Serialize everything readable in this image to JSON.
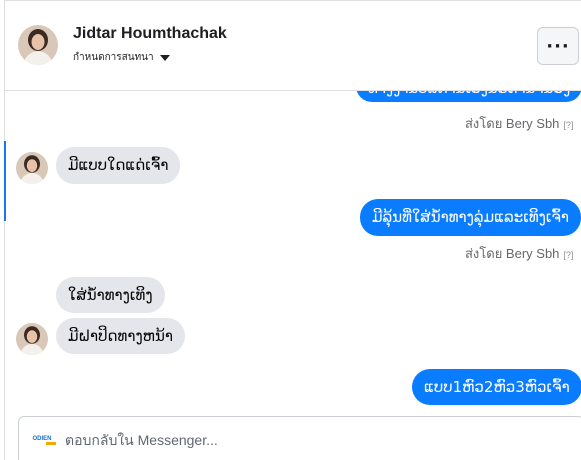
{
  "header": {
    "contact_name": "Jidtar Houmthachak",
    "subtitle": "กำหนดการสนทนา",
    "menu_label": "···"
  },
  "messages": [
    {
      "direction": "outgoing",
      "text": "ທາງງານບໍລິການເອງນະຄ່ານໍ້ານ້ອງ",
      "partially_visible": true
    },
    {
      "direction": "meta",
      "sent_by": "ส่งโดย Bery Sbh",
      "help": "[?]"
    },
    {
      "direction": "incoming",
      "text": "ມີແບບໃດແດ່ເຈົ້າ"
    },
    {
      "direction": "outgoing",
      "text": "ມີລຸ້ນທີ່ໃສ່ນ້ຳທາງລຸ່ມແລະເທິງເຈົ້າ"
    },
    {
      "direction": "meta",
      "sent_by": "ส่งโดย Bery Sbh",
      "help": "[?]"
    },
    {
      "direction": "incoming",
      "text": "ໃສ່ນ້ຳທາງເທິງ"
    },
    {
      "direction": "incoming",
      "text": "ມີຝາປິດທາງຫນ້າ"
    },
    {
      "direction": "outgoing",
      "text": "ແບບ1ຫົວ2ຫົວ3ຫົວເຈົ້າ"
    }
  ],
  "composer": {
    "placeholder": "ตอบกลับใน Messenger...",
    "page_logo_text": "ODIEN"
  },
  "colors": {
    "outgoing_bubble": "#0a7cff",
    "incoming_bubble": "#e4e6eb",
    "accent": "#1877f2"
  },
  "icons": [
    "contact-avatar",
    "dropdown-caret-icon",
    "more-options-icon",
    "page-logo"
  ]
}
